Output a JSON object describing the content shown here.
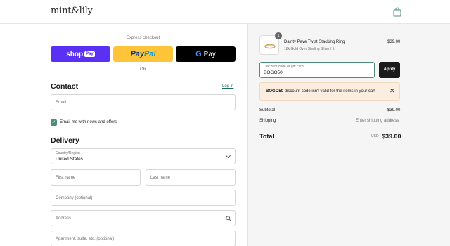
{
  "header": {
    "logo": "mint&lily",
    "cart_icon": "shopping-bag-icon"
  },
  "express": {
    "label": "Express checkout",
    "shop": {
      "label": "shop",
      "badge": "Pay"
    },
    "paypal": {
      "label_a": "Pay",
      "label_b": "Pal"
    },
    "gpay": {
      "g": "G",
      "label": "Pay"
    },
    "or": "OR"
  },
  "contact": {
    "title": "Contact",
    "login": "Log in",
    "email_placeholder": "Email",
    "newsletter_label": "Email me with news and offers",
    "newsletter_checked": true
  },
  "delivery": {
    "title": "Delivery",
    "country_label": "Country/Region",
    "country_value": "United States",
    "first_name_placeholder": "First name",
    "last_name_placeholder": "Last name",
    "company_placeholder": "Company (optional)",
    "address_placeholder": "Address",
    "apartment_placeholder": "Apartment, suite, etc. (optional)"
  },
  "cart": {
    "item": {
      "quantity": "1",
      "name": "Dainty Pave Twist Stacking Ring",
      "variant": "18k Gold Over Sterling Silver / 5",
      "price": "$39.00"
    },
    "discount": {
      "label": "Discount code or gift card",
      "value": "BOGO50",
      "apply_label": "Apply"
    },
    "error": {
      "code": "BOGO50",
      "message": "discount code isn't valid for the items in your cart"
    },
    "subtotal_label": "Subtotal",
    "subtotal_value": "$39.00",
    "shipping_label": "Shipping",
    "shipping_value": "Enter shipping address",
    "total_label": "Total",
    "total_currency": "USD",
    "total_value": "$39.00"
  },
  "colors": {
    "accent": "#4c8c7a",
    "shop_pay": "#5a31f4",
    "paypal": "#ffc439",
    "error_bg": "#fbeee0"
  }
}
